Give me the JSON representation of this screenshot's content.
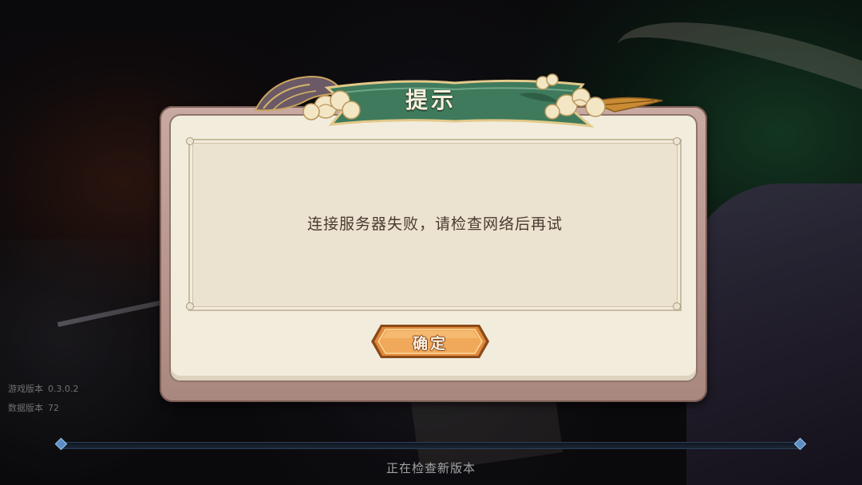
{
  "dialog": {
    "title": "提示",
    "message": "连接服务器失败，请检查网络后再试",
    "confirm_label": "确定"
  },
  "version_info": {
    "game_label": "游戏版本",
    "game_value": "0.3.0.2",
    "data_label": "数据版本",
    "data_value": "72"
  },
  "loading": {
    "status_text": "正在检查新版本",
    "progress": 0
  },
  "colors": {
    "banner_green": "#3f7a5c",
    "button_orange": "#e08a3c",
    "panel_cream": "#f2ecdd",
    "frame_mauve": "#b8968c"
  }
}
